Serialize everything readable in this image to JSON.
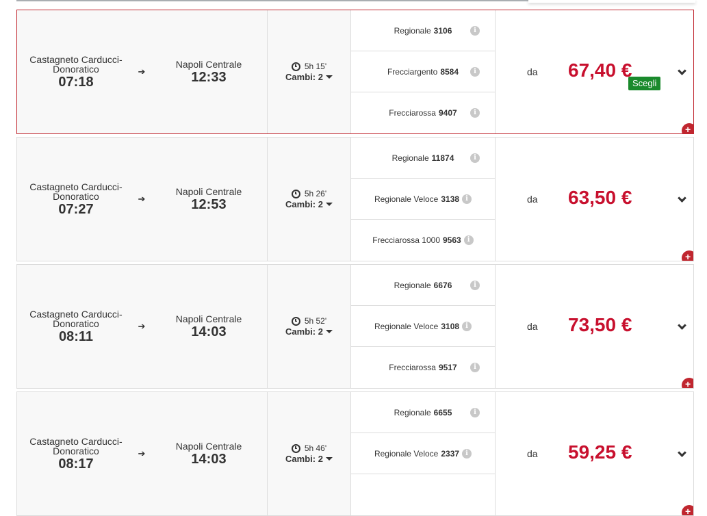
{
  "ui": {
    "scegli_label": "Scegli",
    "da_label": "da",
    "price_color": "#c8102e",
    "selected_border_color": "#c0262f",
    "scegli_color": "#1a8a2c"
  },
  "solutions": [
    {
      "departure_station": "Castagneto Carducci-\nDonoratico",
      "departure_time": "07:18",
      "arrival_station": "Napoli Centrale",
      "arrival_time": "12:33",
      "duration": "5h 15'",
      "changes": "Cambi: 2",
      "price": "67,40 €",
      "selected": true,
      "trains": [
        {
          "category": "Regionale",
          "number": "3106"
        },
        {
          "category": "Frecciargento",
          "number": "8584"
        },
        {
          "category": "Frecciarossa",
          "number": "9407"
        }
      ]
    },
    {
      "departure_station": "Castagneto Carducci-\nDonoratico",
      "departure_time": "07:27",
      "arrival_station": "Napoli Centrale",
      "arrival_time": "12:53",
      "duration": "5h 26'",
      "changes": "Cambi: 2",
      "price": "63,50 €",
      "selected": false,
      "trains": [
        {
          "category": "Regionale",
          "number": "11874"
        },
        {
          "category": "Regionale Veloce",
          "number": "3138"
        },
        {
          "category": "Frecciarossa 1000",
          "number": "9563"
        }
      ]
    },
    {
      "departure_station": "Castagneto Carducci-\nDonoratico",
      "departure_time": "08:11",
      "arrival_station": "Napoli Centrale",
      "arrival_time": "14:03",
      "duration": "5h 52'",
      "changes": "Cambi: 2",
      "price": "73,50 €",
      "selected": false,
      "trains": [
        {
          "category": "Regionale",
          "number": "6676"
        },
        {
          "category": "Regionale Veloce",
          "number": "3108"
        },
        {
          "category": "Frecciarossa",
          "number": "9517"
        }
      ]
    },
    {
      "departure_station": "Castagneto Carducci-\nDonoratico",
      "departure_time": "08:17",
      "arrival_station": "Napoli Centrale",
      "arrival_time": "14:03",
      "duration": "5h 46'",
      "changes": "Cambi: 2",
      "price": "59,25 €",
      "selected": false,
      "trains": [
        {
          "category": "Regionale",
          "number": "6655"
        },
        {
          "category": "Regionale Veloce",
          "number": "2337"
        },
        {
          "category": "",
          "number": ""
        }
      ]
    }
  ]
}
